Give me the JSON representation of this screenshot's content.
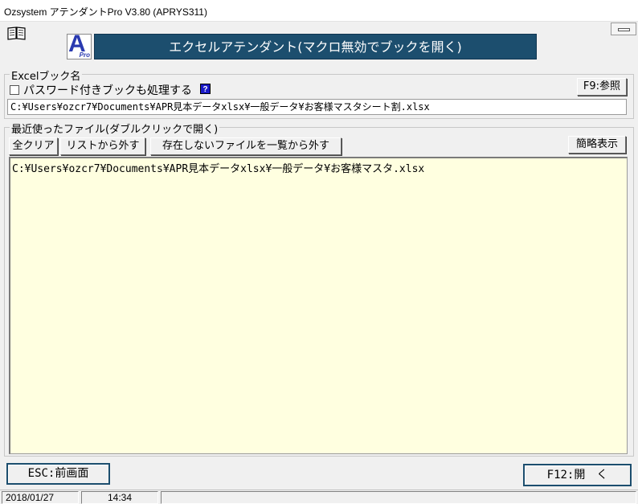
{
  "window": {
    "title": "Ozsystem アテンダントPro V3.80 (APRYS311)"
  },
  "header": {
    "logo_letter": "A",
    "logo_sub": "Pro",
    "banner": "エクセルアテンダント(マクロ無効でブックを開く)"
  },
  "workbook": {
    "group_label": "Excelブック名",
    "password_checkbox_label": "パスワード付きブックも処理する",
    "password_checkbox_checked": false,
    "help_icon": "?",
    "browse_button": "F9:参照",
    "path_value": "C:¥Users¥ozcr7¥Documents¥APR見本データxlsx¥一般データ¥お客様マスタシート割.xlsx"
  },
  "recent": {
    "group_label": "最近使ったファイル(ダブルクリックで開く)",
    "clear_all_button": "全クリア",
    "remove_button": "リストから外す",
    "remove_missing_button": "存在しないファイルを一覧から外す",
    "compact_view_button": "簡略表示",
    "files": [
      "C:¥Users¥ozcr7¥Documents¥APR見本データxlsx¥一般データ¥お客様マスタ.xlsx"
    ]
  },
  "footer": {
    "esc_button": "ESC:前画面",
    "open_button": "F12:開　く"
  },
  "status": {
    "date": "2018/01/27",
    "time": "14:34"
  },
  "colors": {
    "banner_bg": "#1c4e6e",
    "list_bg": "#ffffe0",
    "logo_accent": "#2a3ab0",
    "help_icon_bg": "#1a1ac8"
  }
}
